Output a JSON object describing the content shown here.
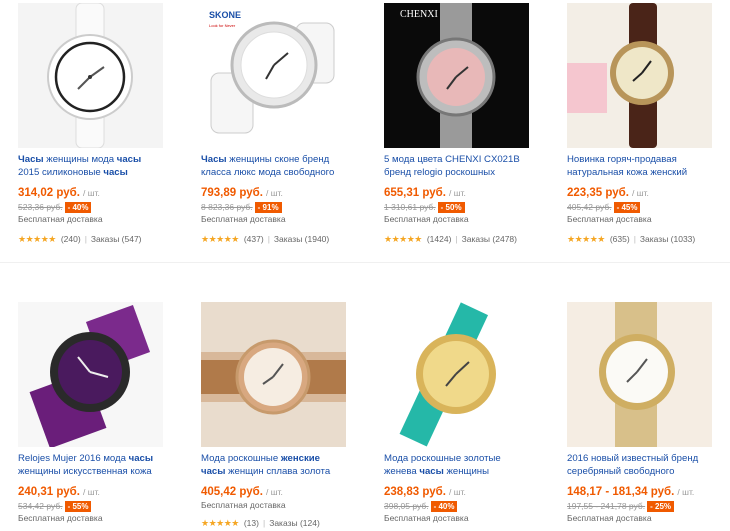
{
  "products": [
    {
      "title_pre": "",
      "title_bold1": "Часы",
      "title_mid": " женщины мода ",
      "title_bold2": "часы",
      "title_post": " 2015 силиконовые ",
      "title_bold3": "часы",
      "price": "314,02 руб.",
      "unit": "/ шт.",
      "old_price": "523,36 руб.",
      "discount": "- 40%",
      "shipping": "Бесплатная доставка",
      "rating_count": "(240)",
      "orders": "Заказы (547)",
      "image": "white-silicone-watch"
    },
    {
      "title_pre": "",
      "title_bold1": "Часы",
      "title_mid": " женщины сконе бренд класса люкс мода свободного",
      "title_bold2": "",
      "title_post": "",
      "title_bold3": "",
      "price": "793,89 руб.",
      "unit": "/ шт.",
      "old_price": "8 823,36 руб.",
      "discount": "- 91%",
      "shipping": "Бесплатная доставка",
      "rating_count": "(437)",
      "orders": "Заказы (1940)",
      "image": "skone-ceramic-watch",
      "brand": "SKONE",
      "brand_tag": "Look for Never"
    },
    {
      "title_pre": "5 мода цвета CHENXI CX021B бренд relogio роскошных",
      "title_bold1": "",
      "title_mid": "",
      "title_bold2": "",
      "title_post": "",
      "title_bold3": "",
      "price": "655,31 руб.",
      "unit": "/ шт.",
      "old_price": "1 310,61 руб.",
      "discount": "- 50%",
      "shipping": "Бесплатная доставка",
      "rating_count": "(1424)",
      "orders": "Заказы (2478)",
      "image": "chenxi-steel-watch",
      "brand": "CHENXI"
    },
    {
      "title_pre": "Новинка горяч-продавая натуральная кожа женский",
      "title_bold1": "",
      "title_mid": "",
      "title_bold2": "",
      "title_post": "",
      "title_bold3": "",
      "price": "223,35 руб.",
      "unit": "/ шт.",
      "old_price": "405,42 руб.",
      "discount": "- 45%",
      "shipping": "Бесплатная доставка",
      "rating_count": "(635)",
      "orders": "Заказы (1033)",
      "image": "vintage-leather-watch"
    },
    {
      "title_pre": "Relojes Mujer 2016 мода ",
      "title_bold1": "часы",
      "title_mid": " женщины искусственная кожа",
      "title_bold2": "",
      "title_post": "",
      "title_bold3": "",
      "price": "240,31 руб.",
      "unit": "/ шт.",
      "old_price": "534,42 руб.",
      "discount": "- 55%",
      "shipping": "Бесплатная доставка",
      "rating_count": "",
      "orders": "",
      "image": "purple-leather-watch"
    },
    {
      "title_pre": "Мода роскошные ",
      "title_bold1": "женские часы",
      "title_mid": " женщин сплава золота",
      "title_bold2": "",
      "title_post": "",
      "title_bold3": "",
      "price": "405,42 руб.",
      "unit": "/ шт.",
      "old_price": "",
      "discount": "",
      "shipping": "Бесплатная доставка",
      "rating_count": "(13)",
      "orders": "Заказы (124)",
      "image": "rose-gold-wrist-watch"
    },
    {
      "title_pre": "Мода роскошные золотые женева ",
      "title_bold1": "часы",
      "title_mid": " женщины",
      "title_bold2": "",
      "title_post": "",
      "title_bold3": "",
      "price": "238,83 руб.",
      "unit": "/ шт.",
      "old_price": "398,05 руб.",
      "discount": "- 40%",
      "shipping": "Бесплатная доставка",
      "rating_count": "",
      "orders": "",
      "image": "teal-geneva-watch"
    },
    {
      "title_pre": "2016 новый известный бренд серебряный свободного",
      "title_bold1": "",
      "title_mid": "",
      "title_bold2": "",
      "title_post": "",
      "title_bold3": "",
      "price": "148,17 - 181,34 руб.",
      "unit": "/ шт.",
      "old_price": "197,55 - 241,78 руб.",
      "discount": "- 25%",
      "shipping": "Бесплатная доставка",
      "rating_count": "",
      "orders": "",
      "image": "gold-mesh-watch"
    }
  ],
  "colors": {
    "price": "#f05a00",
    "link": "#1a4fa8",
    "star": "#f5a623"
  },
  "stars_glyph": "★★★★★"
}
